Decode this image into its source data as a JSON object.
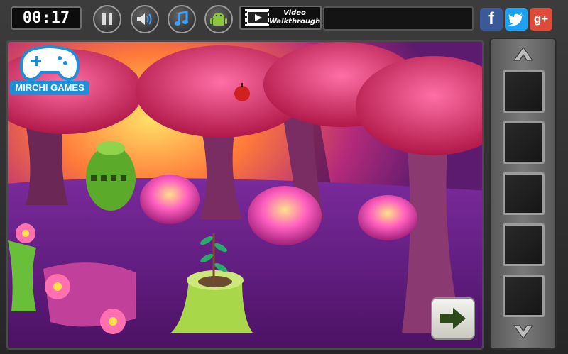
{
  "hud": {
    "timer": "00:17",
    "walkthrough_line1": "Video",
    "walkthrough_line2": "Walkthrough"
  },
  "logo": {
    "text": "MIRCHI GAMES"
  },
  "social": {
    "facebook": "f",
    "google_plus": "g+"
  },
  "icons": {
    "pause": "pause-icon",
    "sound": "speaker-icon",
    "music": "music-note-icon",
    "android": "android-icon",
    "film": "film-icon",
    "twitter": "twitter-bird-icon",
    "next": "arrow-right-icon",
    "inv_up": "chevron-up-icon",
    "inv_down": "chevron-down-icon"
  },
  "colors": {
    "sky_pink": "#d9337a",
    "ground_purple": "#5a1a7a",
    "facebook": "#3b5998",
    "twitter": "#1da1f2",
    "google": "#dd4b39"
  },
  "inventory": {
    "slots": [
      "",
      "",
      "",
      "",
      ""
    ]
  }
}
